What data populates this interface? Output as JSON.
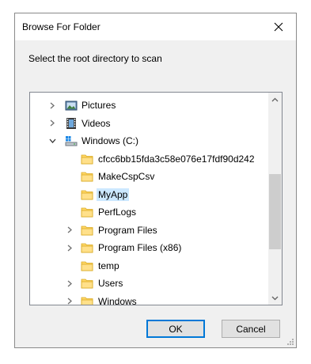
{
  "dialog": {
    "title": "Browse For Folder",
    "prompt": "Select the root directory to scan",
    "ok_label": "OK",
    "cancel_label": "Cancel"
  },
  "tree": {
    "items": [
      {
        "label": "Pictures",
        "icon": "pictures-icon",
        "expander": "collapsed",
        "selected": false
      },
      {
        "label": "Videos",
        "icon": "videos-icon",
        "expander": "collapsed",
        "selected": false
      },
      {
        "label": "Windows (C:)",
        "icon": "drive-icon",
        "expander": "expanded",
        "selected": false
      },
      {
        "label": "cfcc6bb15fda3c58e076e17fdf90d242",
        "icon": "folder-icon",
        "expander": "none",
        "selected": false
      },
      {
        "label": "MakeCspCsv",
        "icon": "folder-icon",
        "expander": "none",
        "selected": false
      },
      {
        "label": "MyApp",
        "icon": "folder-icon",
        "expander": "none",
        "selected": true
      },
      {
        "label": "PerfLogs",
        "icon": "folder-icon",
        "expander": "none",
        "selected": false
      },
      {
        "label": "Program Files",
        "icon": "folder-icon",
        "expander": "collapsed",
        "selected": false
      },
      {
        "label": "Program Files (x86)",
        "icon": "folder-icon",
        "expander": "collapsed",
        "selected": false
      },
      {
        "label": "temp",
        "icon": "folder-icon",
        "expander": "none",
        "selected": false
      },
      {
        "label": "Users",
        "icon": "folder-icon",
        "expander": "collapsed",
        "selected": false
      },
      {
        "label": "Windows",
        "icon": "folder-icon",
        "expander": "collapsed",
        "selected": false
      }
    ],
    "scroll_position": 0.62
  },
  "colors": {
    "selection": "#cce8ff",
    "ok_border": "#0078d7",
    "folder": "#ffd766"
  }
}
